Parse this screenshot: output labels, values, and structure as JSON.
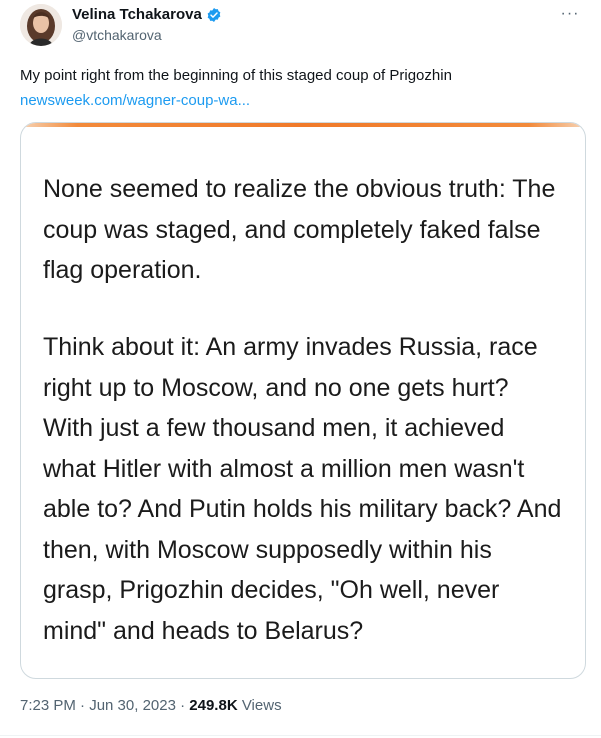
{
  "author": {
    "display_name": "Velina Tchakarova",
    "handle": "@vtchakarova"
  },
  "more_icon": "···",
  "tweet": {
    "text": "My point right from the beginning of this staged coup of Prigozhin",
    "link": "newsweek.com/wagner-coup-wa..."
  },
  "media": {
    "paragraph_1": "None seemed to realize the obvious truth: The coup was staged, and completely faked false flag operation.",
    "paragraph_2": "Think about it: An army invades Russia, race right up to Moscow, and no one gets hurt? With just a few thousand men, it achieved what Hitler with almost a million men wasn't able to? And Putin holds his military back? And then, with Moscow supposedly within his grasp, Prigozhin decides, \"Oh well, never mind\" and heads to Belarus?"
  },
  "meta": {
    "timestamp": "7:23 PM · Jun 30, 2023",
    "separator": " · ",
    "views_count": "249.8K",
    "views_label": " Views"
  },
  "colors": {
    "link": "#1d9bf0",
    "verified": "#1d9bf0",
    "accent_bar": "#f07a2a",
    "secondary_text": "#536471"
  },
  "icons": {
    "verified": "verified-badge-icon",
    "more": "more-options-icon"
  }
}
